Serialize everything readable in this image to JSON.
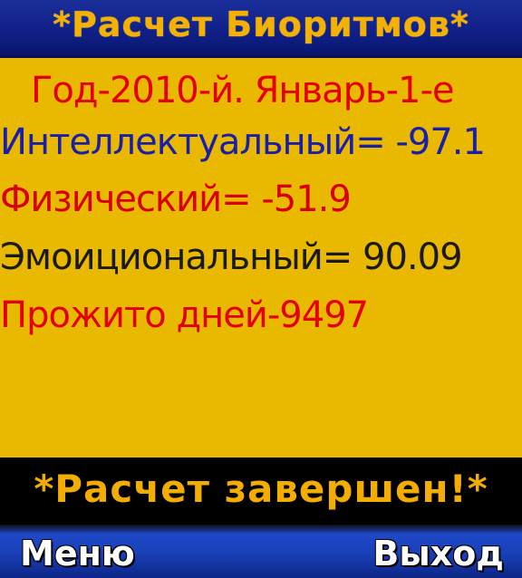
{
  "app": {
    "title": "*Расчет Биоритмов*"
  },
  "results": {
    "date_line": "Год-2010-й. Январь-1-е",
    "intellectual": "Интеллектуальный= -97.1",
    "physical": "Физический= -51.9",
    "emotional": "Эмоициональный= 90.09",
    "days_lived": "Прожито дней-9497"
  },
  "status": {
    "text": "*Расчет завершен!*"
  },
  "softkeys": {
    "left_label": "Меню",
    "right_label": "Выход"
  },
  "colors": {
    "background": "#e9b800",
    "title_bar": "#0f1f86",
    "title_text": "#f5b100",
    "status_bar": "#000000",
    "status_text": "#f2ad00",
    "softkey_bar": "#1a40b8",
    "red_text": "#e50000",
    "blue_text": "#1a1fa8"
  }
}
